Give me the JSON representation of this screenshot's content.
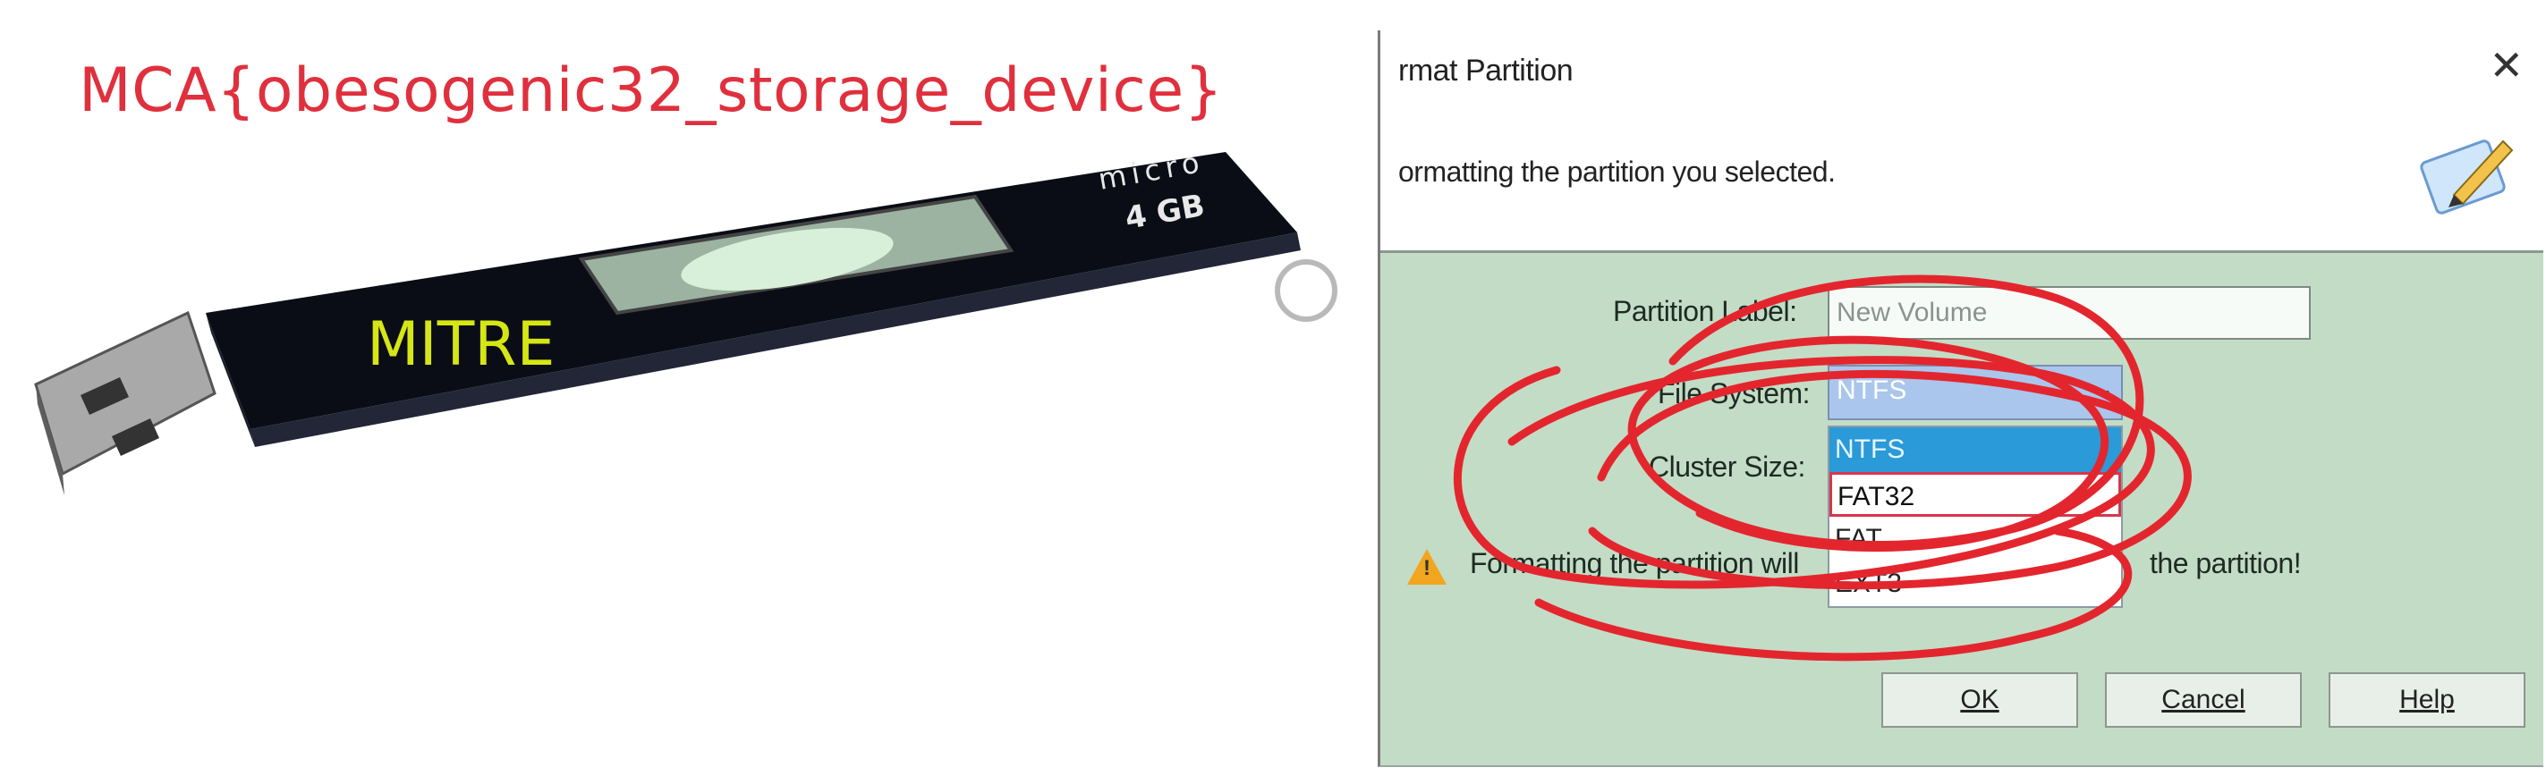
{
  "caption": {
    "flag": "MCA{obesogenic32_storage_device}",
    "drive_brand": "MITRE",
    "drive_model": "micro",
    "drive_capacity": "4 GB"
  },
  "dialog": {
    "title": "rmat Partition",
    "close_glyph": "✕",
    "description": "ormatting the partition you selected.",
    "fields": {
      "partition_label": {
        "label": "Partition Label:",
        "value": "New Volume"
      },
      "file_system": {
        "label": "File System:",
        "selected": "NTFS",
        "options": [
          "NTFS",
          "FAT32",
          "FAT",
          "EXT3"
        ]
      },
      "cluster_size": {
        "label": "Cluster Size:"
      }
    },
    "warning": {
      "text_start": "Formatting the partition will",
      "text_end": "the partition!"
    },
    "buttons": {
      "ok": "OK",
      "cancel": "Cancel",
      "help": "Help"
    }
  },
  "colors": {
    "flag_text": "#e0303d",
    "brand_text": "#d6e614",
    "dialog_bg": "#c3dcc6",
    "scribble": "#e3262e"
  },
  "icons": [
    "close-icon",
    "edit-pencil-icon",
    "warning-icon",
    "chevron-down-icon"
  ]
}
